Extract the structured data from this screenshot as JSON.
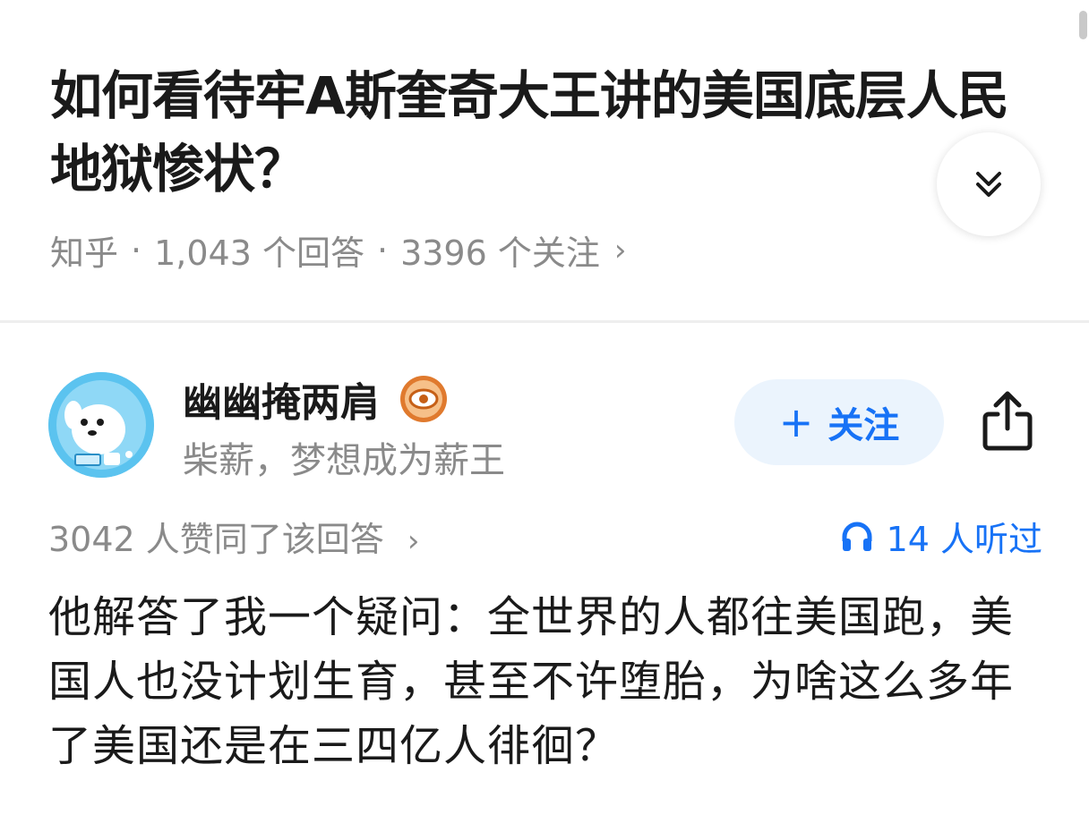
{
  "question": {
    "title": "如何看待牢A斯奎奇大王讲的美国底层人民地狱惨状？"
  },
  "meta": {
    "source": "知乎",
    "separator": "·",
    "answers": "1,043 个回答",
    "followers": "3396 个关注",
    "chevron": "›"
  },
  "author": {
    "name": "幽幽掩两肩",
    "bio": "柴薪，梦想成为薪王",
    "follow_plus": "+",
    "follow_label": "关注"
  },
  "stats": {
    "upvotes": "3042 人赞同了该回答",
    "chevron": "›",
    "listeners": "14 人听过"
  },
  "answer": {
    "text": "他解答了我一个疑问：全世界的人都往美国跑，美国人也没计划生育，甚至不许堕胎，为啥这么多年了美国还是在三四亿人徘徊？"
  },
  "icons": {
    "collapse": "double-chevron-down-icon",
    "share": "share-icon",
    "badge": "eye-badge-icon",
    "listen": "headphones-icon"
  },
  "colors": {
    "accent": "#1772f6",
    "follow_bg": "#ebf4fd",
    "muted_text": "#8a8a8a",
    "badge": "#e07a2e"
  }
}
